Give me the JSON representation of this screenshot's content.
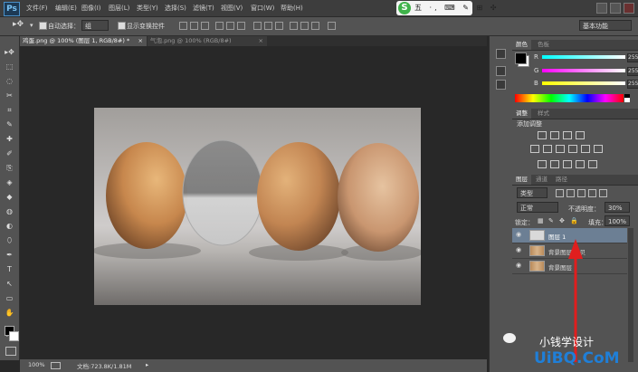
{
  "app": {
    "logo": "Ps"
  },
  "menu": {
    "items": [
      "文件(F)",
      "编辑(E)",
      "图像(I)",
      "图层(L)",
      "类型(Y)",
      "选择(S)",
      "滤镜(T)",
      "视图(V)",
      "窗口(W)",
      "帮助(H)"
    ]
  },
  "ime": {
    "logo": "S",
    "text": "五 ·, ⌨ ✎ ⊞ ✣"
  },
  "options": {
    "auto_select_label": "自动选择：",
    "auto_select_value": "组",
    "show_transform_label": "显示变换控件",
    "workspace": "基本功能"
  },
  "tabs": [
    {
      "label": "鸡蛋.png @ 100% (图层 1, RGB/8#) *",
      "active": true
    },
    {
      "label": "气泡.png @ 100% (RGB/8#)",
      "active": false
    }
  ],
  "tools": [
    "▸✥",
    "⬚",
    "◌",
    "✂",
    "⌗",
    "✎",
    "✚",
    "✐",
    "⎘",
    "◈",
    "◆",
    "◍",
    "◐",
    "⬯",
    "✒",
    "T",
    "↖",
    "▭",
    "✋",
    "⌕",
    "⋯"
  ],
  "status": {
    "zoom": "100%",
    "doc": "文档:723.8K/1.81M"
  },
  "panels": {
    "color": {
      "tabs": [
        "颜色",
        "色板"
      ],
      "channels": [
        {
          "label": "R",
          "value": "255"
        },
        {
          "label": "G",
          "value": "255"
        },
        {
          "label": "B",
          "value": "255"
        }
      ]
    },
    "adjustments": {
      "tabs": [
        "调整",
        "样式"
      ],
      "title": "添加调整"
    },
    "layers": {
      "tabs": [
        "图层",
        "通道",
        "路径"
      ],
      "kind": "类型",
      "blend_mode": "正常",
      "opacity_label": "不透明度：",
      "opacity_value": "30%",
      "lock_label": "锁定：",
      "fill_label": "填充：",
      "fill_value": "100%",
      "items": [
        {
          "name": "图层 1",
          "selected": true
        },
        {
          "name": "背景图层 拷贝",
          "selected": false
        },
        {
          "name": "背景图层",
          "selected": false
        }
      ]
    }
  },
  "watermark": {
    "wechat": "小钱学设计",
    "site": "UiBQ.CoM"
  }
}
